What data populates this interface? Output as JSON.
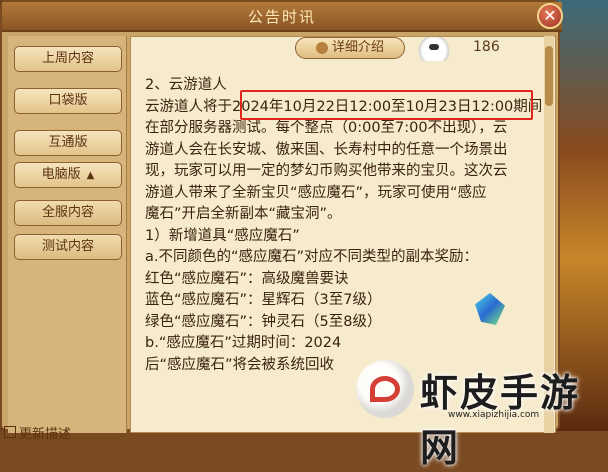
{
  "window": {
    "title": "公告时讯",
    "close_label": "✕"
  },
  "sidebar": {
    "items": [
      {
        "label": "上周内容"
      },
      {
        "label": "口袋版"
      },
      {
        "label": "互通版"
      },
      {
        "label": "电脑版",
        "arrow": "▲"
      },
      {
        "label": "全服内容"
      },
      {
        "label": "测试内容"
      }
    ]
  },
  "topbar": {
    "detail_label": "详细介绍",
    "count": "186"
  },
  "content": {
    "lines": [
      "2、云游道人",
      "云游道人将于2024年10月22日12:00至10月23日12:00期间",
      "在部分服务器测试。每个整点（0:00至7:00不出现），云",
      "游道人会在长安城、傲来国、长寿村中的任意一个场景出",
      "现，玩家可以用一定的梦幻币购买他带来的宝贝。这次云",
      "游道人带来了全新宝贝“感应魔石”，玩家可使用“感应",
      "魔石”开启全新副本“藏宝洞”。",
      "1）新增道具“感应魔石”",
      "a.不同颜色的“感应魔石”对应不同类型的副本奖励：",
      "红色“感应魔石”：高级魔兽要诀",
      "蓝色“感应魔石”：星辉石（3至7级）",
      "绿色“感应魔石”：钟灵石（5至8级）",
      "b.“感应魔石”过期时间：2024",
      "后“感应魔石”将会被系统回收"
    ]
  },
  "bottom": {
    "check_label": "更新描述"
  },
  "watermark": {
    "text": "虾皮手游网",
    "url": "www.xiapizhijia.com"
  }
}
